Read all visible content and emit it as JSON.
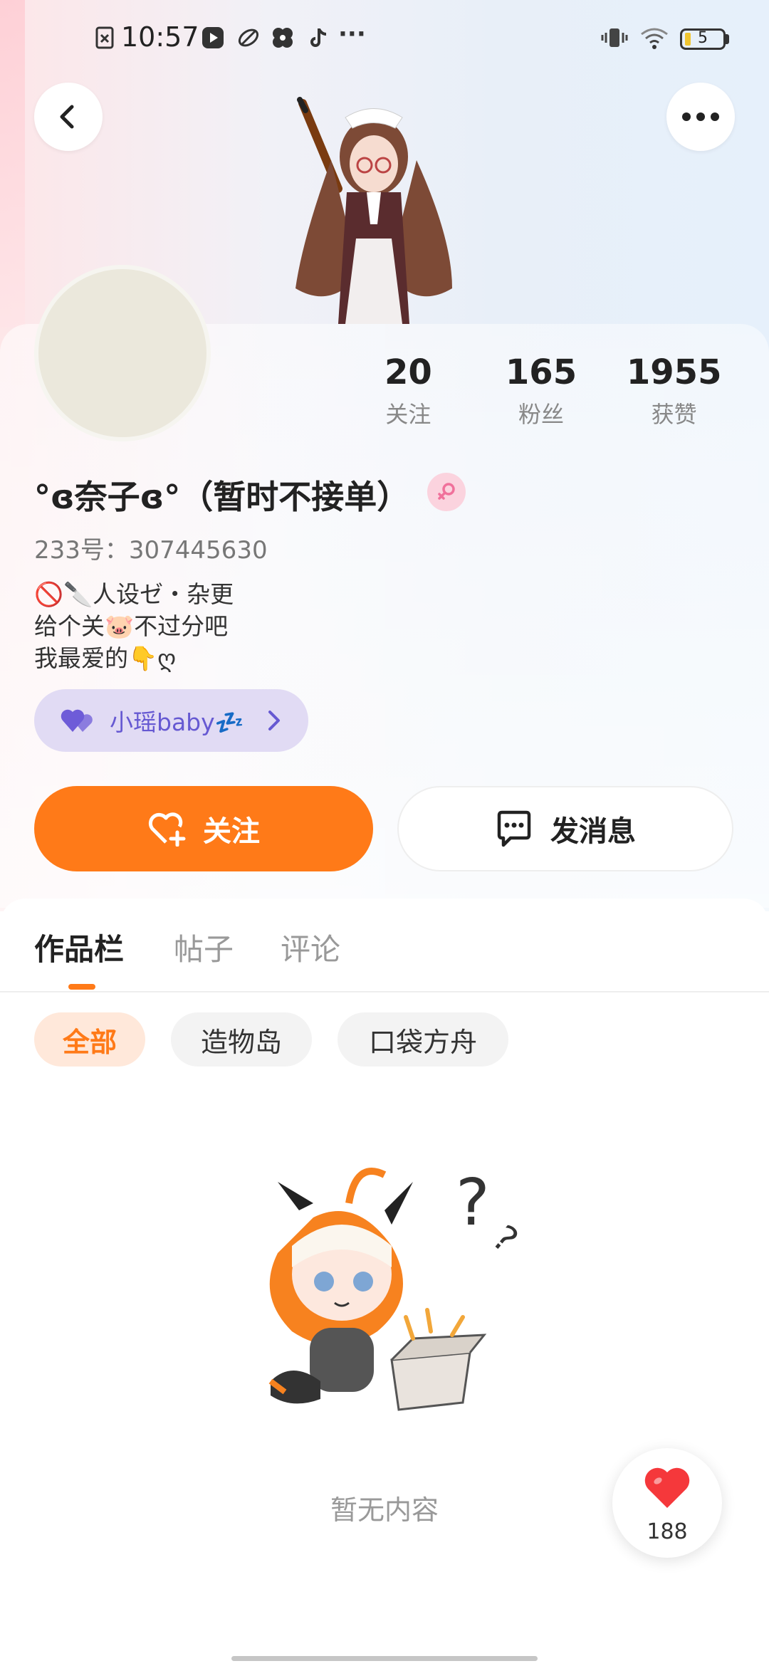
{
  "status_bar": {
    "time": "10:57",
    "more": "···",
    "battery": "5"
  },
  "profile": {
    "stats": [
      {
        "value": "20",
        "label": "关注"
      },
      {
        "value": "165",
        "label": "粉丝"
      },
      {
        "value": "1955",
        "label": "获赞"
      }
    ],
    "nickname": "°ɞ奈子ɞ°（暂时不接单）",
    "uid": "233号：307445630",
    "bio": [
      "🚫🔪人设ゼ・杂更",
      " 给个关🐷不过分吧",
      "我最爱的👇ღ"
    ],
    "fan_group": "小瑶baby💤"
  },
  "actions": {
    "follow": "关注",
    "message": "发消息"
  },
  "tabs": [
    "作品栏",
    "帖子",
    "评论"
  ],
  "filters": [
    "全部",
    "造物岛",
    "口袋方舟"
  ],
  "empty_text": "暂无内容",
  "like_count": "188",
  "colors": {
    "accent": "#ff7a18",
    "fan_pill_bg": "#e1dbf4",
    "fan_pill_text": "#6659d2"
  }
}
